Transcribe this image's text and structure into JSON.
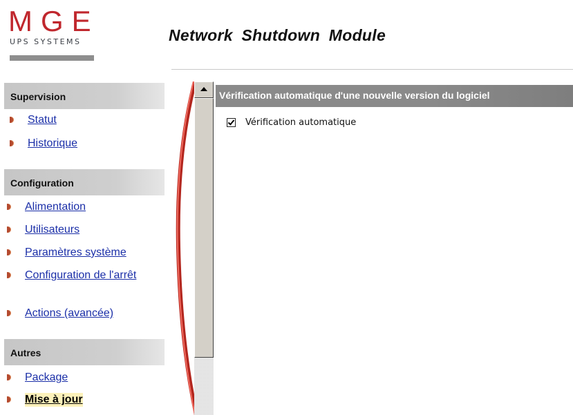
{
  "header": {
    "logo_main": "MGE",
    "logo_sub": "UPS SYSTEMS",
    "title": "Network  Shutdown  Module"
  },
  "sidebar": {
    "sections": [
      {
        "title": "Supervision",
        "items": [
          "Statut",
          "Historique"
        ]
      },
      {
        "title": "Configuration",
        "items": [
          "Alimentation",
          "Utilisateurs",
          "Paramètres système",
          "Configuration de l'arrêt",
          "Actions (avancée)"
        ]
      },
      {
        "title": "Autres",
        "items": [
          "Package",
          "Mise à jour"
        ]
      }
    ],
    "active_item": "Mise à jour"
  },
  "main": {
    "section_title": "Vérification automatique d'une nouvelle version du logiciel",
    "checkbox": {
      "label": "Vérification automatique",
      "checked": true
    }
  },
  "colors": {
    "logo_red": "#c0272d",
    "link_blue": "#1b2fa8",
    "section_gray": "#c6c6c6",
    "content_header": "#8a8a8a",
    "active_highlight": "#fcf1ba"
  }
}
